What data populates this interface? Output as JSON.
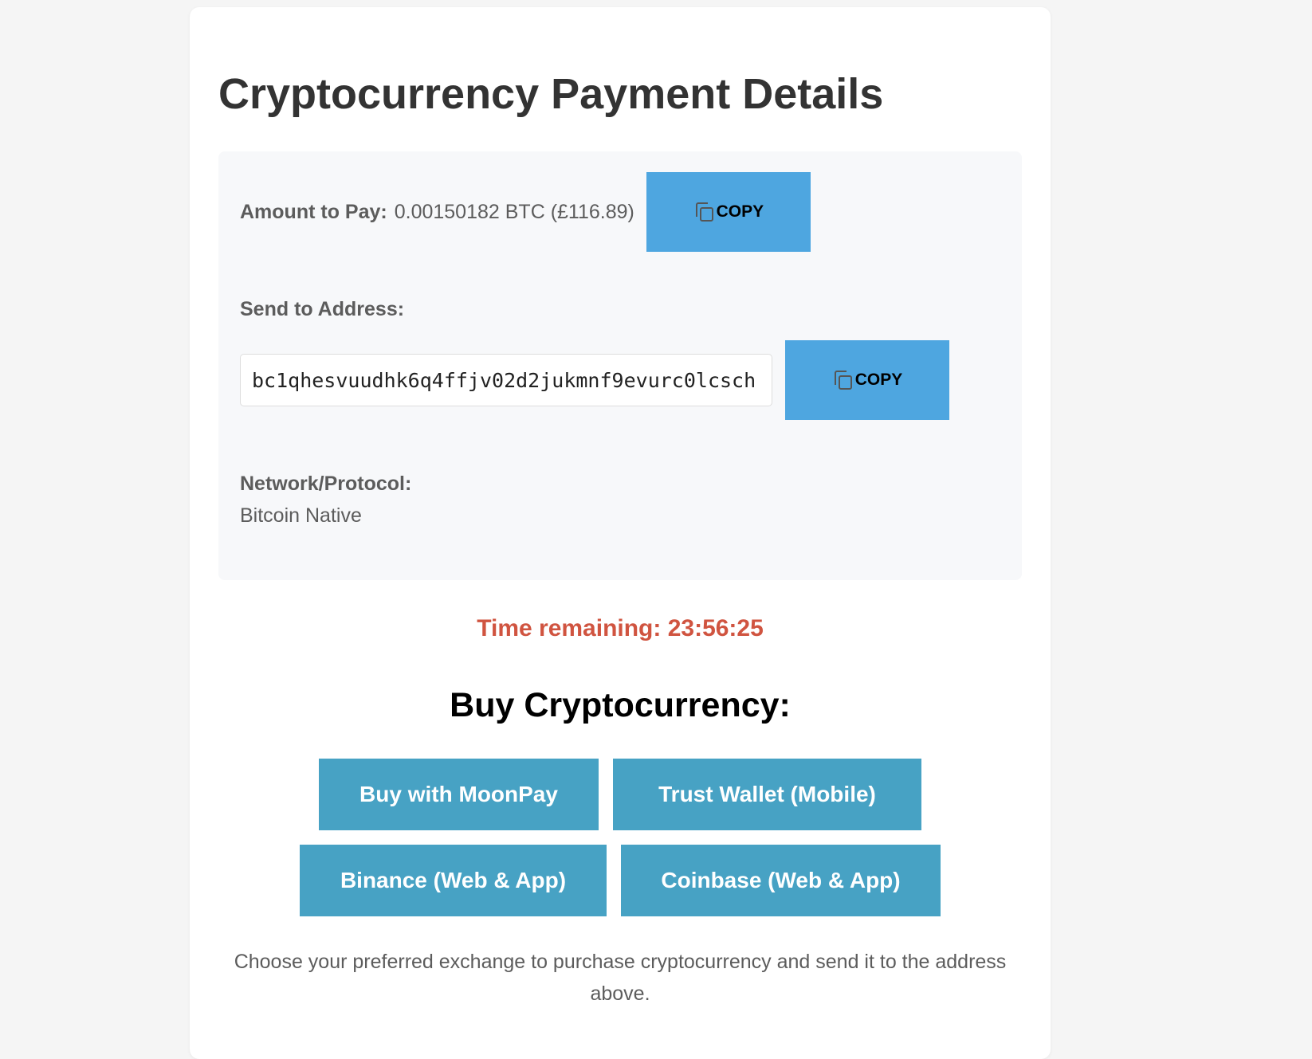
{
  "page": {
    "title": "Cryptocurrency Payment Details"
  },
  "payment": {
    "amount_label": "Amount to Pay:",
    "amount_value": "0.00150182 BTC (£116.89)",
    "copy_label": "COPY",
    "address_label": "Send to Address:",
    "address_value": "bc1qhesvuudhk6q4ffjv02d2jukmnf9evurc0lcsch",
    "network_label": "Network/Protocol:",
    "network_value": "Bitcoin Native"
  },
  "timer": {
    "text": "Time remaining: 23:56:25"
  },
  "buy": {
    "title": "Buy Cryptocurrency:",
    "buttons": [
      "Buy with MoonPay",
      "Trust Wallet (Mobile)",
      "Binance (Web & App)",
      "Coinbase (Web & App)"
    ],
    "note": "Choose your preferred exchange to purchase cryptocurrency and send it to the address above."
  },
  "icons": {
    "copy": "copy-icon"
  },
  "colors": {
    "page_background": "#f5f5f5",
    "card_background": "#ffffff",
    "details_background": "#f7f8fa",
    "copy_button": "#4ea6e0",
    "exchange_button": "#47a2c4",
    "timer_text": "#d05440",
    "title_text": "#333333",
    "body_text": "#5c5c5c"
  }
}
